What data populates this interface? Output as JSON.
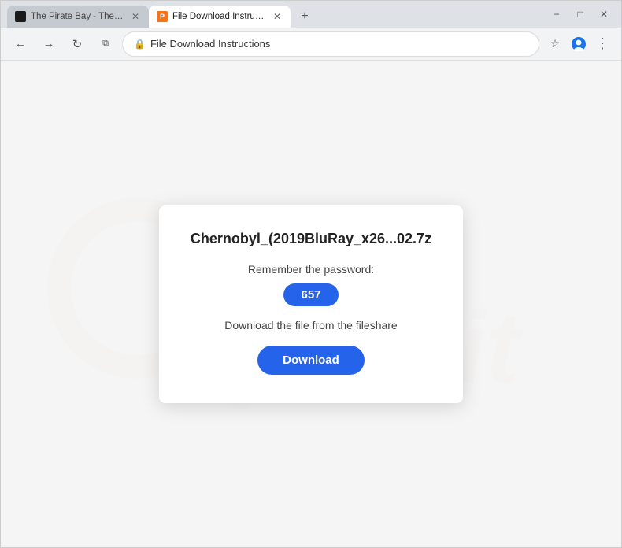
{
  "browser": {
    "tabs": [
      {
        "id": "tab-pirate",
        "favicon": "pirate",
        "title": "The Pirate Bay - The galaxy's m...",
        "active": false
      },
      {
        "id": "tab-filedownload",
        "favicon": "pf",
        "title": "File Download Instructions for...",
        "active": true
      }
    ],
    "new_tab_label": "+",
    "window_controls": {
      "minimize": "−",
      "maximize": "□",
      "close": "✕"
    },
    "nav": {
      "back_disabled": false,
      "forward_disabled": false,
      "reload_label": "↻",
      "address": "file download instructions",
      "bookmark_icon": "★",
      "profile_icon": "👤",
      "menu_icon": "⋮"
    }
  },
  "modal": {
    "filename": "Chernobyl_(2019BluRay_x26...02.7z",
    "remember_label": "Remember the password:",
    "password": "657",
    "instruction": "Download the file from the fileshare",
    "download_button": "Download"
  },
  "watermark": {
    "text": "fish.clit"
  }
}
